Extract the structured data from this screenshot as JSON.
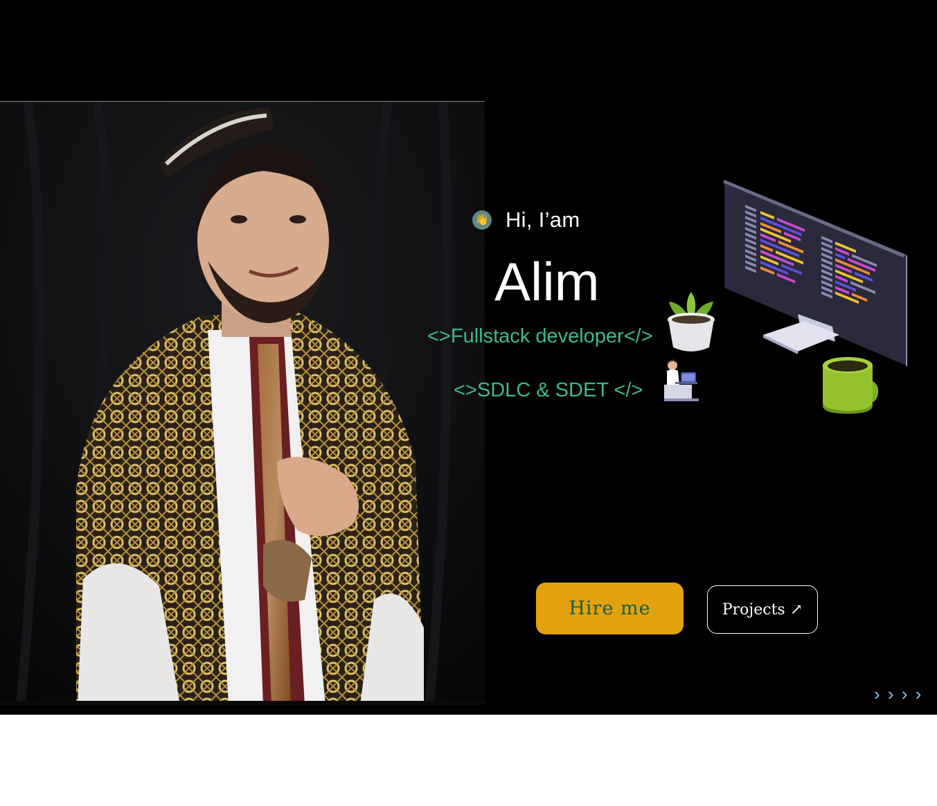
{
  "hero": {
    "greeting": "Hi, I’am",
    "greeting_icon": "waving-hand-icon",
    "name": "Alim",
    "role_primary": "<>Fullstack developer</>",
    "role_secondary": "<>SDLC & SDET </>",
    "hire_label": "Hire me",
    "projects_label": "Projects ↗",
    "scroll_indicator": "› › › ›"
  },
  "illustrations": [
    "plant-pot-icon",
    "developer-at-desk-icon",
    "code-monitor-icon",
    "coffee-mug-icon"
  ],
  "colors": {
    "background": "#000000",
    "accent_green": "#3fb98a",
    "button_gold": "#e2a20e",
    "button_text_green": "#1d5a44"
  }
}
